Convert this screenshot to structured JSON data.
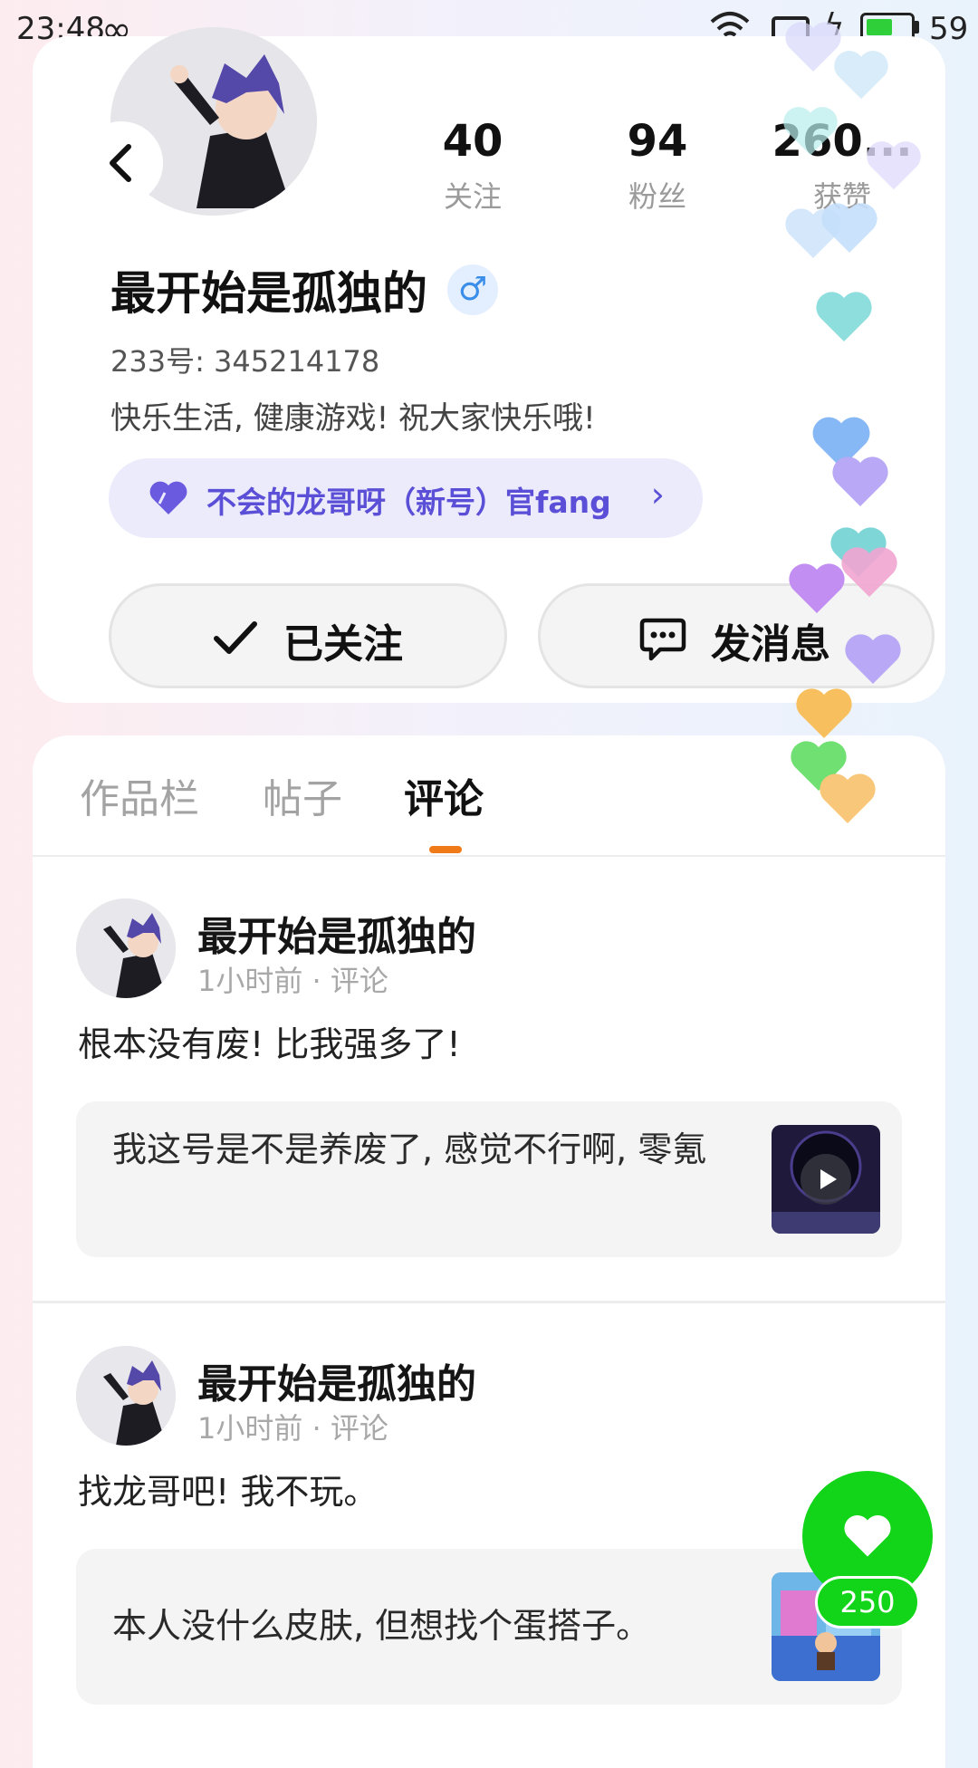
{
  "status_bar": {
    "time": "23:48",
    "battery_percent": "59",
    "battery_level": 0.59
  },
  "profile": {
    "stats": [
      {
        "value": "40",
        "label": "关注"
      },
      {
        "value": "94",
        "label": "粉丝"
      },
      {
        "value": "260...",
        "label": "获赞"
      }
    ],
    "username": "最开始是孤独的",
    "gender_symbol": "♂",
    "uid_text": "233号: 345214178",
    "bio": "快乐生活, 健康游戏! 祝大家快乐哦!",
    "fan_tag": "不会的龙哥呀（新号）官fang",
    "follow_button": "已关注",
    "message_button": "发消息"
  },
  "tabs": [
    {
      "label": "作品栏",
      "active": false
    },
    {
      "label": "帖子",
      "active": false
    },
    {
      "label": "评论",
      "active": true
    }
  ],
  "posts": [
    {
      "author": "最开始是孤独的",
      "meta": "1小时前 · 评论",
      "text": "根本没有废! 比我强多了!",
      "quote": "我这号是不是养废了, 感觉不行啊, 零氪",
      "thumb_icon": "play-icon"
    },
    {
      "author": "最开始是孤独的",
      "meta": "1小时前 · 评论",
      "text": "找龙哥吧! 我不玩。",
      "quote": "本人没什么皮肤, 但想找个蛋搭子。",
      "thumb_icon": "game-scene-image"
    }
  ],
  "like": {
    "count": "250"
  },
  "colors": {
    "accent_orange": "#f07a18",
    "like_green": "#12d51a",
    "fan_tag_purple": "#5a4fd6"
  }
}
